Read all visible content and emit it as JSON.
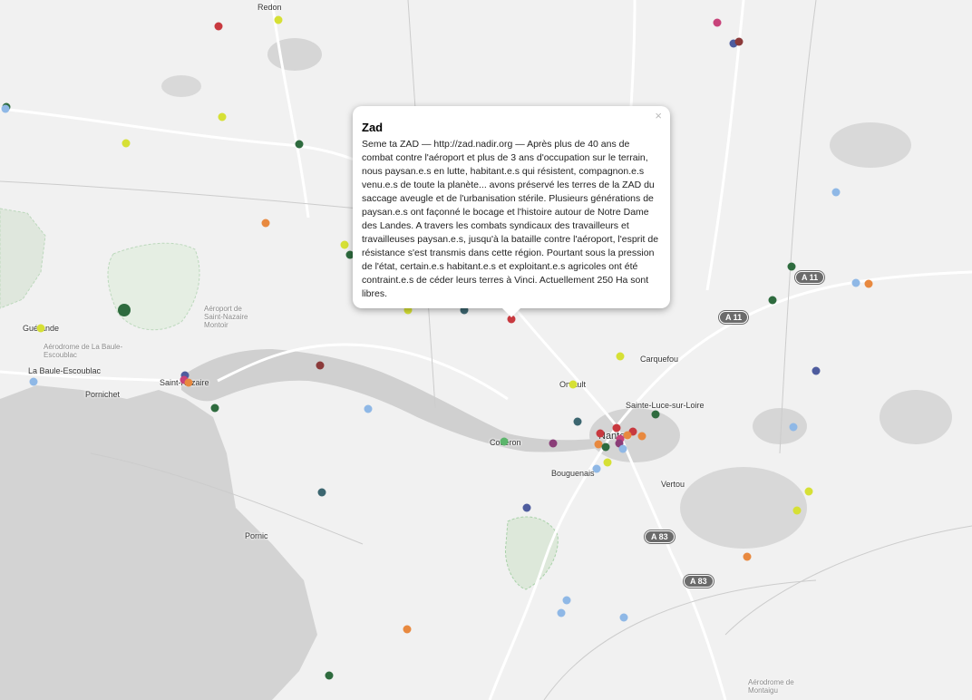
{
  "map": {
    "places": [
      {
        "name": "Redon"
      },
      {
        "name": "Guérande"
      },
      {
        "name": "La Baule-Escoublac"
      },
      {
        "name": "Pornichet"
      },
      {
        "name": "Saint-Nazaire"
      },
      {
        "name": "Carquefou"
      },
      {
        "name": "Orvault"
      },
      {
        "name": "Sainte-Luce-sur-Loire"
      },
      {
        "name": "Nantes"
      },
      {
        "name": "Couëron"
      },
      {
        "name": "Bouguenais"
      },
      {
        "name": "Vertou"
      },
      {
        "name": "Pornic"
      }
    ],
    "minor_labels": [
      {
        "name": "Aérodrome de La Baule-Escoublac"
      },
      {
        "name": "Aéroport de Saint-Nazaire Montoir"
      },
      {
        "name": "Aérodrome de Montaigu"
      }
    ],
    "roads": [
      {
        "label": "A 11"
      },
      {
        "label": "A 11"
      },
      {
        "label": "A 83"
      },
      {
        "label": "A 83"
      }
    ],
    "marker_colors": {
      "red": "#c8393f",
      "yellow": "#d6e035",
      "darkgreen": "#2e6b3e",
      "orange": "#e8893f",
      "lightblue": "#8fb8e6",
      "navy": "#4e5c9e",
      "teal": "#3c6670",
      "pink": "#c8437a",
      "purple": "#8a3d78",
      "brown": "#8b3a3a",
      "green": "#5bb56b"
    }
  },
  "popup": {
    "title": "Zad",
    "body": "Seme ta ZAD — http://zad.nadir.org — Après plus de 40 ans de combat contre l'aéroport et plus de 3 ans d'occupation sur le terrain, nous paysan.e.s en lutte, habitant.e.s qui résistent, compagnon.e.s venu.e.s de toute la planète... avons préservé les terres de la ZAD du saccage aveugle et de l'urbanisation stérile. Plusieurs générations de paysan.e.s ont façonné le bocage et l'histoire autour de Notre Dame des Landes. A travers les combats syndicaux des travailleurs et travailleuses paysan.e.s, jusqu'à la bataille contre l'aéroport, l'esprit de résistance s'est transmis dans cette région. Pourtant sous la pression de l'état, certain.e.s habitant.e.s et exploitant.e.s agricoles ont été contraint.e.s de céder leurs terres à Vinci. Actuellement 250 Ha sont libres.",
    "close_label": "×"
  }
}
